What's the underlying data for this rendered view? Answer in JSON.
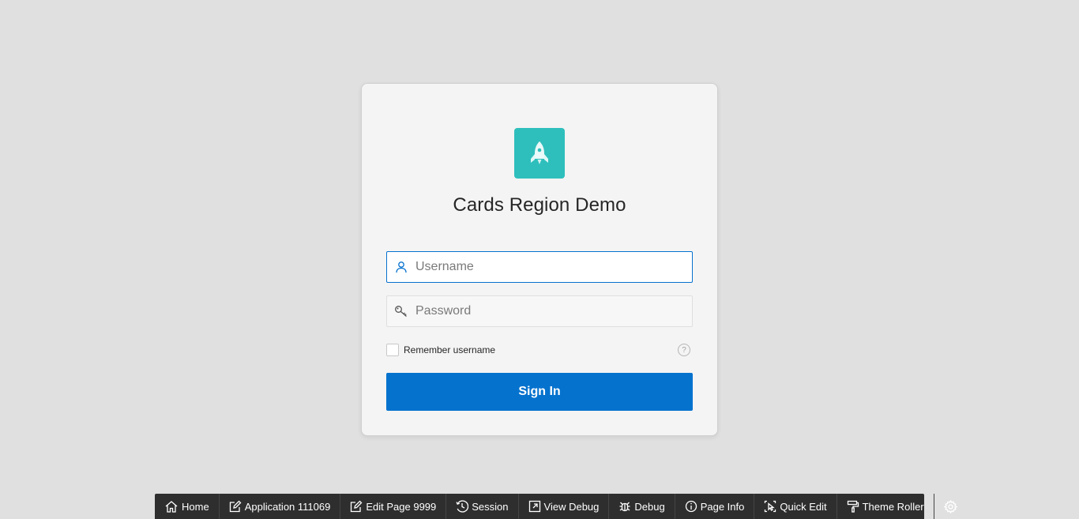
{
  "login": {
    "title": "Cards Region Demo",
    "username_placeholder": "Username",
    "password_placeholder": "Password",
    "remember_label": "Remember username",
    "help_glyph": "?",
    "sign_in_label": "Sign In"
  },
  "toolbar": {
    "home": "Home",
    "application": "Application 111069",
    "edit_page": "Edit Page 9999",
    "session": "Session",
    "view_debug": "View Debug",
    "debug": "Debug",
    "page_info": "Page Info",
    "quick_edit": "Quick Edit",
    "theme_roller": "Theme Roller"
  },
  "colors": {
    "accent": "#0572ce",
    "app_icon_bg": "#2ebfbc",
    "toolbar_bg": "#2e2e2e"
  },
  "icons": {
    "app": "rocket-icon",
    "username": "user-icon",
    "password": "key-icon",
    "help": "question-circle-icon",
    "settings": "gear-icon"
  }
}
